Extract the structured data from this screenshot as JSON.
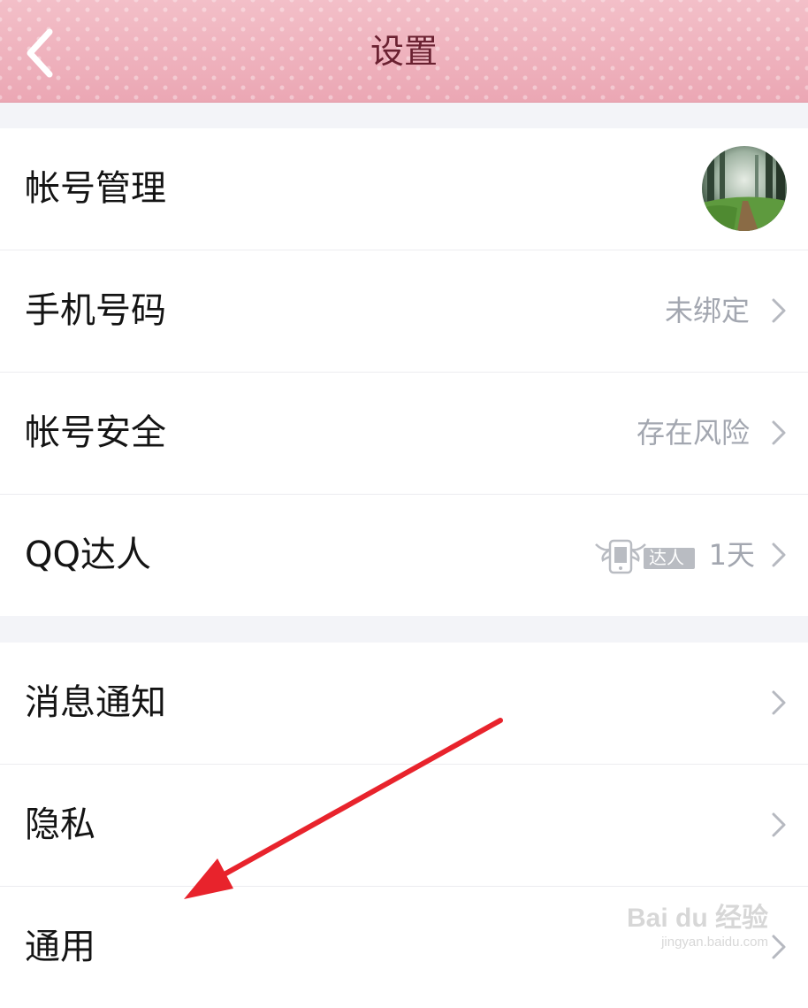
{
  "header": {
    "title": "设置",
    "back_icon": "chevron-left-icon",
    "background_color": "#f0b2bd",
    "title_color": "#6a2131"
  },
  "group1": {
    "rows": [
      {
        "label": "帐号管理",
        "value": "",
        "trailing": "avatar"
      },
      {
        "label": "手机号码",
        "value": "未绑定",
        "trailing": "chevron-right-icon"
      },
      {
        "label": "帐号安全",
        "value": "存在风险",
        "trailing": "chevron-right-icon"
      },
      {
        "label": "QQ达人",
        "value": "1天",
        "badge_text": "达人",
        "trailing": "chevron-right-icon"
      }
    ]
  },
  "group2": {
    "rows": [
      {
        "label": "消息通知",
        "trailing": "chevron-right-icon"
      },
      {
        "label": "隐私",
        "trailing": "chevron-right-icon"
      },
      {
        "label": "通用",
        "trailing": "chevron-right-icon"
      }
    ]
  },
  "annotation": {
    "icon": "red-arrow-icon",
    "color": "#e8232c"
  },
  "watermark": {
    "logo": "Bai du 经验",
    "url": "jingyan.baidu.com"
  },
  "colors": {
    "value_text": "#a3a7b0",
    "separator": "#ececf0",
    "page_background": "#f3f4f8"
  }
}
